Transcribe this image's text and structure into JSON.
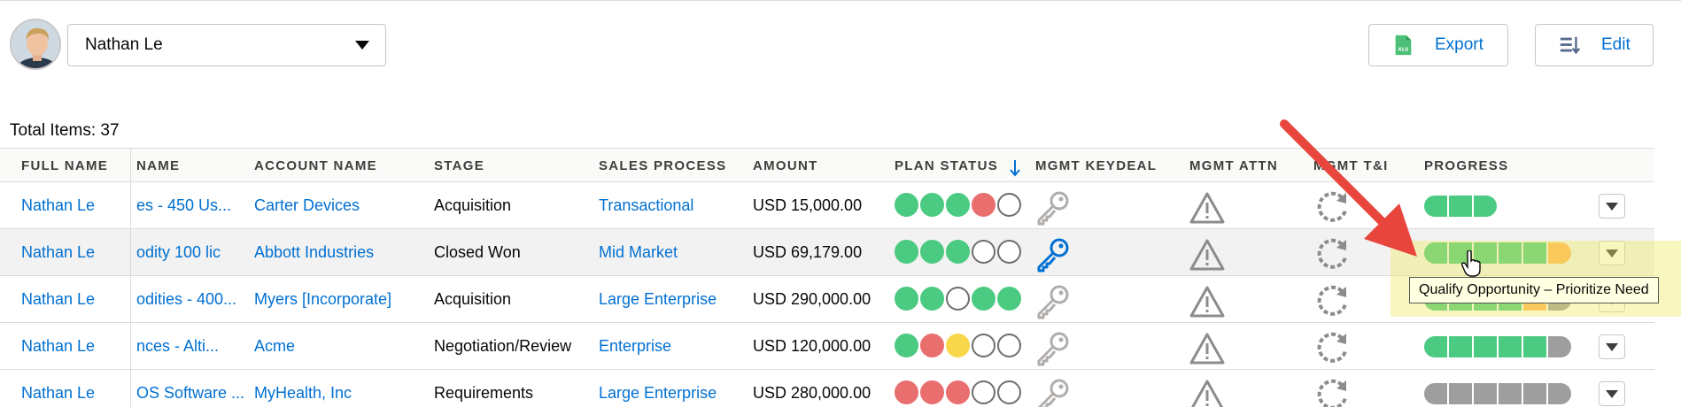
{
  "header": {
    "user_name": "Nathan Le",
    "export_label": "Export",
    "edit_label": "Edit"
  },
  "summary": {
    "total_items": "Total Items: 37"
  },
  "columns": {
    "full_name": "FULL NAME",
    "name": "NAME",
    "account_name": "ACCOUNT NAME",
    "stage": "STAGE",
    "sales_process": "SALES PROCESS",
    "amount": "AMOUNT",
    "plan_status": "PLAN STATUS",
    "mgmt_keydeal": "MGMT KEYDEAL",
    "mgmt_attn": "MGMT ATTN",
    "mgmt_ti": "MGMT T&I",
    "progress": "PROGRESS"
  },
  "rows": [
    {
      "full_name": "Nathan Le",
      "name": "es - 450 Us...",
      "account": "Carter Devices",
      "stage": "Acquisition",
      "sales_process": "Transactional",
      "amount": "USD 15,000.00",
      "plan_status": [
        "green",
        "green",
        "green",
        "red",
        "empty"
      ],
      "keydeal": false,
      "progress": [
        "green",
        "green",
        "green"
      ]
    },
    {
      "full_name": "Nathan Le",
      "name": "odity 100 lic",
      "account": "Abbott Industries",
      "stage": "Closed Won",
      "sales_process": "Mid Market",
      "amount": "USD 69,179.00",
      "plan_status": [
        "green",
        "green",
        "green",
        "empty",
        "empty"
      ],
      "keydeal": true,
      "progress": [
        "green",
        "green",
        "green",
        "green",
        "green",
        "orange"
      ]
    },
    {
      "full_name": "Nathan Le",
      "name": "odities - 400...",
      "account": "Myers [Incorporate]",
      "stage": "Acquisition",
      "sales_process": "Large Enterprise",
      "amount": "USD 290,000.00",
      "plan_status": [
        "green",
        "green",
        "empty",
        "green",
        "green"
      ],
      "keydeal": false,
      "progress": [
        "green",
        "green",
        "green",
        "green",
        "orange",
        "gray"
      ]
    },
    {
      "full_name": "Nathan Le",
      "name": "nces - Alti...",
      "account": "Acme",
      "stage": "Negotiation/Review",
      "sales_process": "Enterprise",
      "amount": "USD 120,000.00",
      "plan_status": [
        "green",
        "red",
        "yellow",
        "empty",
        "empty"
      ],
      "keydeal": false,
      "progress": [
        "green",
        "green",
        "green",
        "green",
        "green",
        "gray"
      ]
    },
    {
      "full_name": "Nathan Le",
      "name": "OS Software ...",
      "account": "MyHealth, Inc",
      "stage": "Requirements",
      "sales_process": "Large Enterprise",
      "amount": "USD 280,000.00",
      "plan_status": [
        "red",
        "red",
        "red",
        "empty",
        "empty"
      ],
      "keydeal": false,
      "progress": [
        "gray",
        "gray",
        "gray",
        "gray",
        "gray",
        "gray"
      ]
    }
  ],
  "tooltip": "Qualify Opportunity – Prioritize Need",
  "colors": {
    "link": "#0070d2",
    "green": "#4bca81",
    "red": "#e96e6e",
    "yellow": "#f8d84a",
    "orange": "#ffb75d",
    "gray": "#9e9e9e",
    "annotation_arrow": "#e8453c",
    "highlight": "#eeeb5a"
  }
}
